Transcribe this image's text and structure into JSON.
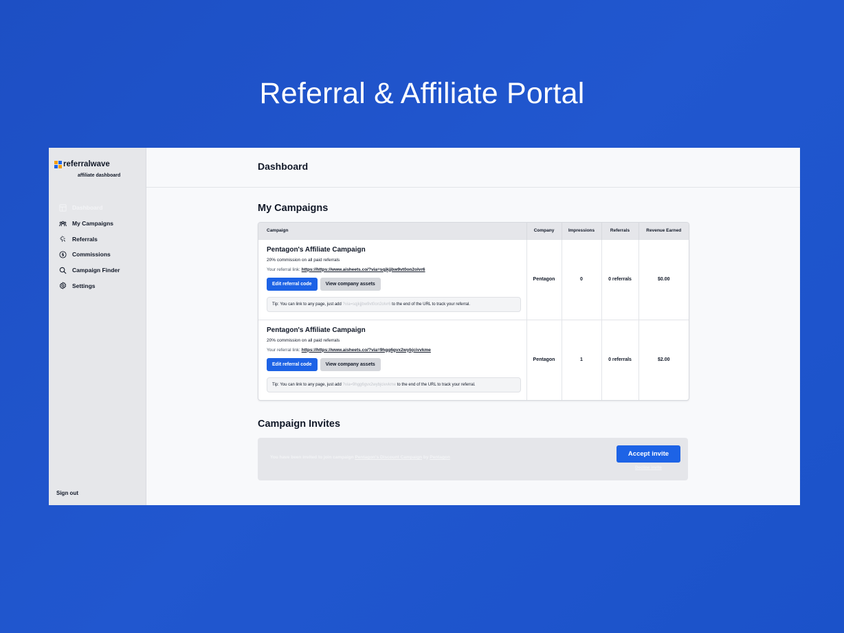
{
  "page_heading": "Referral & Affiliate Portal",
  "sidebar": {
    "logo_text": "referralwave",
    "logo_sub": "affiliate dashboard",
    "logo_colors": [
      "#f59e0b",
      "#1d63e6",
      "#1d63e6",
      "#f59e0b"
    ],
    "items": [
      {
        "label": "Dashboard",
        "icon": "dashboard-icon",
        "active": true
      },
      {
        "label": "My Campaigns",
        "icon": "users-icon",
        "active": false
      },
      {
        "label": "Referrals",
        "icon": "sparkle-icon",
        "active": false
      },
      {
        "label": "Commissions",
        "icon": "dollar-circle-icon",
        "active": false
      },
      {
        "label": "Campaign Finder",
        "icon": "search-icon",
        "active": false
      },
      {
        "label": "Settings",
        "icon": "gear-icon",
        "active": false
      }
    ],
    "sign_out": "Sign out"
  },
  "header": {
    "title": "Dashboard"
  },
  "campaigns": {
    "title": "My Campaigns",
    "columns": [
      "Campaign",
      "Company",
      "Impressions",
      "Referrals",
      "Revenue Earned"
    ],
    "rows": [
      {
        "name": "Pentagon's Affiliate Campaign",
        "description": "20% commission on all paid referrals",
        "link_label": "Your referral link:",
        "link_url": "https://https://www.aisheets.co/?via=sqjkjjbw9vt0on2olvr6",
        "edit_label": "Edit referral code",
        "assets_label": "View company assets",
        "tip_prefix": "Tip: You can link to any page, just add",
        "tip_code": "?via=sqjkjjbw9vt0on2olvr6",
        "tip_suffix": "to the end of the URL to track your referral.",
        "company": "Pentagon",
        "impressions": "0",
        "referrals": "0 referrals",
        "revenue": "$0.00"
      },
      {
        "name": "Pentagon's Affiliate Campaign",
        "description": "20% commission on all paid referrals",
        "link_label": "Your referral link:",
        "link_url": "https://https://www.aisheets.co/?via=9hgg6gvx2wybjcivvkme",
        "edit_label": "Edit referral code",
        "assets_label": "View company assets",
        "tip_prefix": "Tip: You can link to any page, just add",
        "tip_code": "?via=9hgg6gvx2wybjcivvkme",
        "tip_suffix": "to the end of the URL to track your referral.",
        "company": "Pentagon",
        "impressions": "1",
        "referrals": "0 referrals",
        "revenue": "$2.00"
      }
    ]
  },
  "invites": {
    "title": "Campaign Invites",
    "text_prefix": "You have been invited to join campaign",
    "campaign_name": "Pentagon's Discount Campaign",
    "text_by": "by",
    "company": "Pentagon",
    "accept_label": "Accept invite",
    "decline_label": "Decline invite"
  },
  "colors": {
    "primary": "#1d63e6",
    "background": "#1f54c9"
  }
}
